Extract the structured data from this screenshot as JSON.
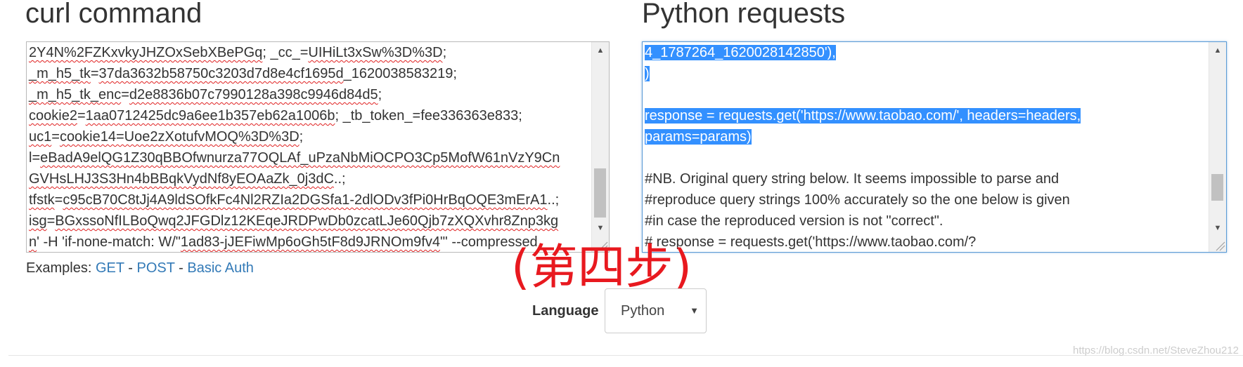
{
  "curl": {
    "heading": "curl command",
    "lines": [
      [
        "",
        "2Y4N%2FZKxvkyJHZOxSebXBePGq",
        "; _cc_=",
        "UIHiLt3xSw%3D%3D",
        ";"
      ],
      [
        "",
        "_m_h5_tk",
        "=",
        "37da3632b58750c3203d7d8e4cf1695d",
        "_1620038583219;"
      ],
      [
        "",
        "_m_h5_tk_enc",
        "=",
        "d2e8836b07c7990128a398c9946d84d5",
        ";"
      ],
      [
        "",
        "cookie2",
        "=",
        "1aa0712425dc9a6ee1b357eb62a1006b",
        "; _tb_token_=fee336363e833;"
      ],
      [
        "",
        "uc1",
        "=",
        "cookie14=Uoe2zXotufvMOQ%3D%3D",
        ";"
      ],
      [
        "l=",
        "eBadA9elQG1Z30qBBOfwnurza77OQLAf_uPzaNbMiOCPO3Cp5MofW61nVzY9Cn",
        "",
        "",
        ""
      ],
      [
        "",
        "GVHsLHJ3S3Hn4bBBqkVydNf8yEOAaZk_0j3dC",
        "..;",
        "",
        ""
      ],
      [
        "",
        "tfstk",
        "=",
        "c95cB70C8tJj4A9ldSOfkFc4Nl2RZIa2DGSfa1-2dlODv3fPi0HrBqOQE3mErA1",
        "..;"
      ],
      [
        "",
        "isg",
        "=",
        "BGxssoNfILBoQwq2JFGDlz12KEqeJRDPwDb0zcatLJe60Qjb7zXQXvhr8Znp3kg",
        ""
      ],
      [
        "",
        "n",
        "' -H 'if-none-match: W/\"",
        "1ad83-jJEFiwMp6oGh5tF8d9JRNOm9fv4",
        "\"' --compressed"
      ]
    ]
  },
  "python": {
    "heading": "Python requests",
    "lines": [
      {
        "text": "4_1787264_1620028142850'),",
        "selected": true
      },
      {
        "text": ")",
        "selected": true
      },
      {
        "text": " ",
        "selected": true
      },
      {
        "text": "response = requests.get('https://www.taobao.com/', headers=headers, ",
        "selected": true
      },
      {
        "text": "params=params)",
        "selected": true
      },
      {
        "text": "",
        "selected": false
      },
      {
        "text": "#NB. Original query string below. It seems impossible to parse and",
        "selected": false
      },
      {
        "text": "#reproduce query strings 100% accurately so the one below is given",
        "selected": false
      },
      {
        "text": "#in case the reproduced version is not \"correct\".",
        "selected": false
      },
      {
        "text": "# response = requests.get('https://www.taobao.com/?",
        "selected": false
      }
    ]
  },
  "examples": {
    "label": "Examples:",
    "links": [
      "GET",
      "POST",
      "Basic Auth"
    ],
    "separator": "-"
  },
  "annotation": "(第四步)",
  "language": {
    "label": "Language",
    "selected": "Python"
  },
  "watermark": "https://blog.csdn.net/SteveZhou212",
  "colors": {
    "link": "#337ab7",
    "selection": "#3390ff",
    "annotation": "#e8191f",
    "spellcheck": "#e02020"
  }
}
